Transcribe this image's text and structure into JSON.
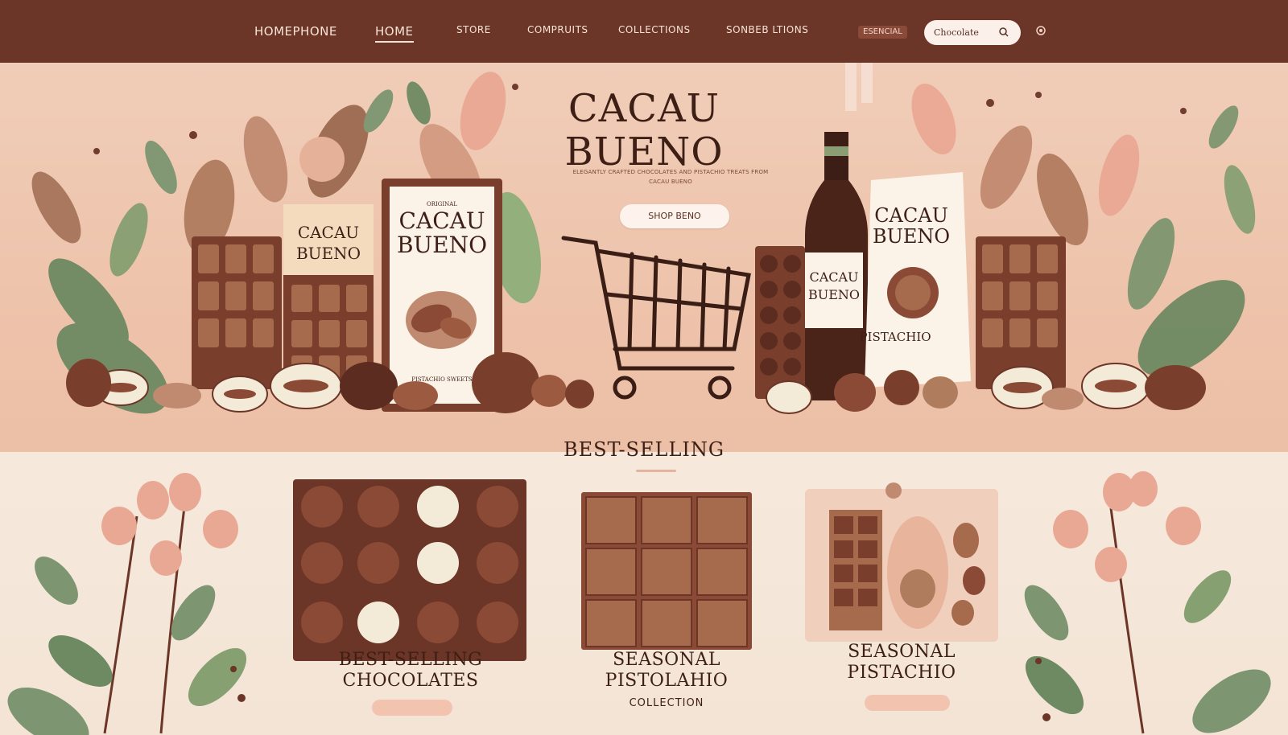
{
  "nav": {
    "brand": "HOMEPHONE",
    "items": [
      {
        "label": "HOME",
        "active": true
      },
      {
        "label": "STORE"
      },
      {
        "label": "COMPRUITS"
      },
      {
        "label": "COLLECTIONS"
      },
      {
        "label": "SONBEB  LTIONS"
      }
    ],
    "pill": "ESENCIAL",
    "search_value": "Chocolate",
    "icons": [
      "search-icon",
      "circle-icon"
    ]
  },
  "hero": {
    "title_line1": "CACAU",
    "title_line2": "BUENO",
    "tagline": "ELEGANTLY CRAFTED CHOCOLATES AND PISTACHIO TREATS FROM CACAU BUENO",
    "cta": "SHOP BENO",
    "package_left_small": [
      "CACAU",
      "BUENO"
    ],
    "package_left_big": [
      "CACAU",
      "BUENO"
    ],
    "package_left_big_top": "ORIGINAL",
    "package_left_big_foot": "PISTACHIO SWEETS",
    "bottle_label": [
      "CACAU",
      "BUENO"
    ],
    "package_right": [
      "CACAU",
      "BUENO"
    ],
    "package_right_flavor": "PISTACHIO"
  },
  "best_selling": {
    "heading": "BEST-SELLING",
    "cards": [
      {
        "title1": "BEST-SELLING",
        "title2": "CHOCOLATES",
        "sub": ""
      },
      {
        "title1": "SEASONAL",
        "title2": "PISTOLAHIO",
        "sub": "COLLECTION"
      },
      {
        "title1": "SEASONAL",
        "title2": "PISTACHIO",
        "sub": ""
      }
    ]
  },
  "colors": {
    "nav": "#6b3527",
    "hero_bg": "#eec3ab",
    "chocolate": "#7a3f2c",
    "chocolate_light": "#a66a4d",
    "leaf": "#7d9570",
    "pink": "#e9a894",
    "cream": "#f6e9dc"
  }
}
